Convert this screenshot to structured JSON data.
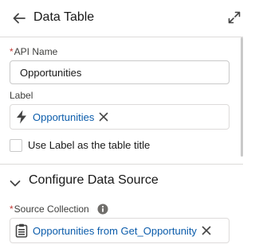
{
  "header": {
    "title": "Data Table"
  },
  "api_name": {
    "required_marker": "*",
    "label": "API Name",
    "value": "Opportunities"
  },
  "label_field": {
    "label": "Label",
    "pill_text": "Opportunities",
    "pill_icon": "lightning-bolt-icon"
  },
  "table_title_option": {
    "label": "Use Label as the table title",
    "checked": false
  },
  "section": {
    "title": "Configure Data Source",
    "expanded": true
  },
  "source_collection": {
    "required_marker": "*",
    "label": "Source Collection",
    "info_icon": "info-icon",
    "pill_text": "Opportunities from Get_Opportunity",
    "pill_icon": "collection-icon"
  },
  "colors": {
    "link": "#0b5cab",
    "required": "#c23934",
    "border": "#c9c9c9",
    "icon_dark": "#444444"
  }
}
